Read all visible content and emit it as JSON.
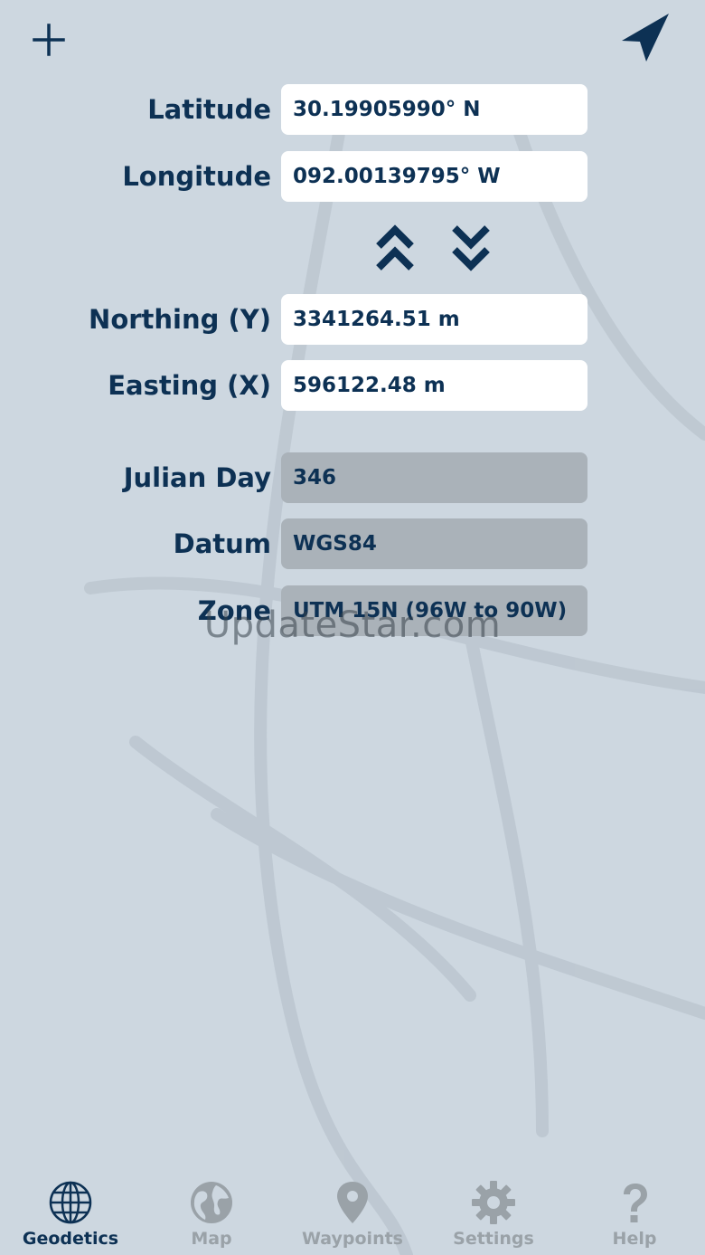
{
  "fields": {
    "latitude": {
      "label": "Latitude",
      "value": "30.19905990° N"
    },
    "longitude": {
      "label": "Longitude",
      "value": "092.00139795° W"
    },
    "northing": {
      "label": "Northing (Y)",
      "value": "3341264.51 m"
    },
    "easting": {
      "label": "Easting (X)",
      "value": "596122.48 m"
    },
    "julian_day": {
      "label": "Julian Day",
      "value": "346"
    },
    "datum": {
      "label": "Datum",
      "value": "WGS84"
    },
    "zone": {
      "label": "Zone",
      "value": "UTM 15N (96W to 90W)"
    }
  },
  "watermark": "UpdateStar.com",
  "tabs": [
    {
      "label": "Geodetics",
      "icon": "globe-icon",
      "active": true
    },
    {
      "label": "Map",
      "icon": "earth-icon",
      "active": false
    },
    {
      "label": "Waypoints",
      "icon": "map-pin-icon",
      "active": false
    },
    {
      "label": "Settings",
      "icon": "gear-icon",
      "active": false
    },
    {
      "label": "Help",
      "icon": "question-icon",
      "active": false
    }
  ],
  "colors": {
    "background": "#cdd7e0",
    "accent": "#0d3154",
    "field_editable": "#ffffff",
    "field_readonly": "#aab2b9",
    "tab_inactive": "#9aa2a8"
  }
}
